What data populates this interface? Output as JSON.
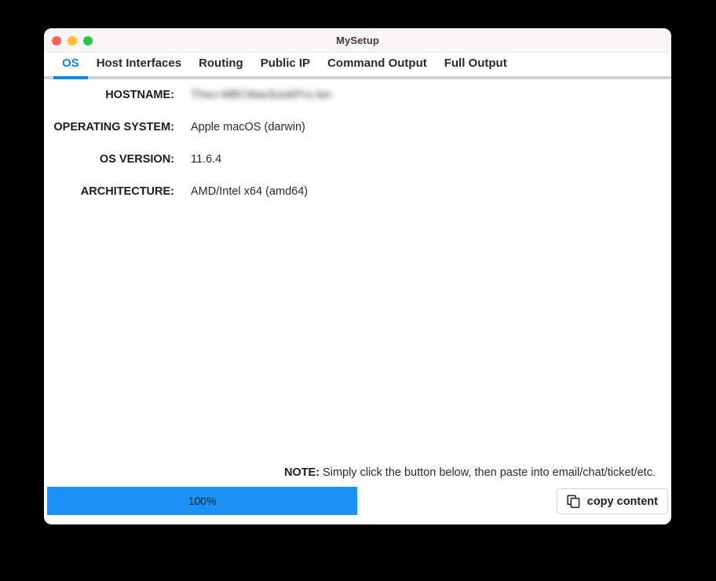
{
  "window": {
    "title": "MySetup",
    "controls": {
      "close": "close-button",
      "minimize": "minimize-button",
      "maximize": "zoom-button"
    },
    "accent_color": "#0c87e8",
    "titlebar_color": "#f9f4f5"
  },
  "tabs": [
    {
      "label": "OS",
      "active": true
    },
    {
      "label": "Host Interfaces",
      "active": false
    },
    {
      "label": "Routing",
      "active": false
    },
    {
      "label": "Public IP",
      "active": false
    },
    {
      "label": "Command Output",
      "active": false
    },
    {
      "label": "Full Output",
      "active": false
    }
  ],
  "os_panel": {
    "rows": [
      {
        "label": "HOSTNAME:",
        "value": "Theo-MBCMacbookPro.lan",
        "redacted": true
      },
      {
        "label": "OPERATING SYSTEM:",
        "value": "Apple macOS (darwin)",
        "redacted": false
      },
      {
        "label": "OS VERSION:",
        "value": "11.6.4",
        "redacted": false
      },
      {
        "label": "ARCHITECTURE:",
        "value": "AMD/Intel x64 (amd64)",
        "redacted": false
      }
    ]
  },
  "note": {
    "label": "NOTE:",
    "text": "Simply click the button below, then paste into email/chat/ticket/etc."
  },
  "footer": {
    "progress": {
      "label": "100%",
      "percent": 100,
      "color": "#1a92f5"
    },
    "copy_button": {
      "label": "copy content",
      "icon": "copy-icon"
    }
  }
}
